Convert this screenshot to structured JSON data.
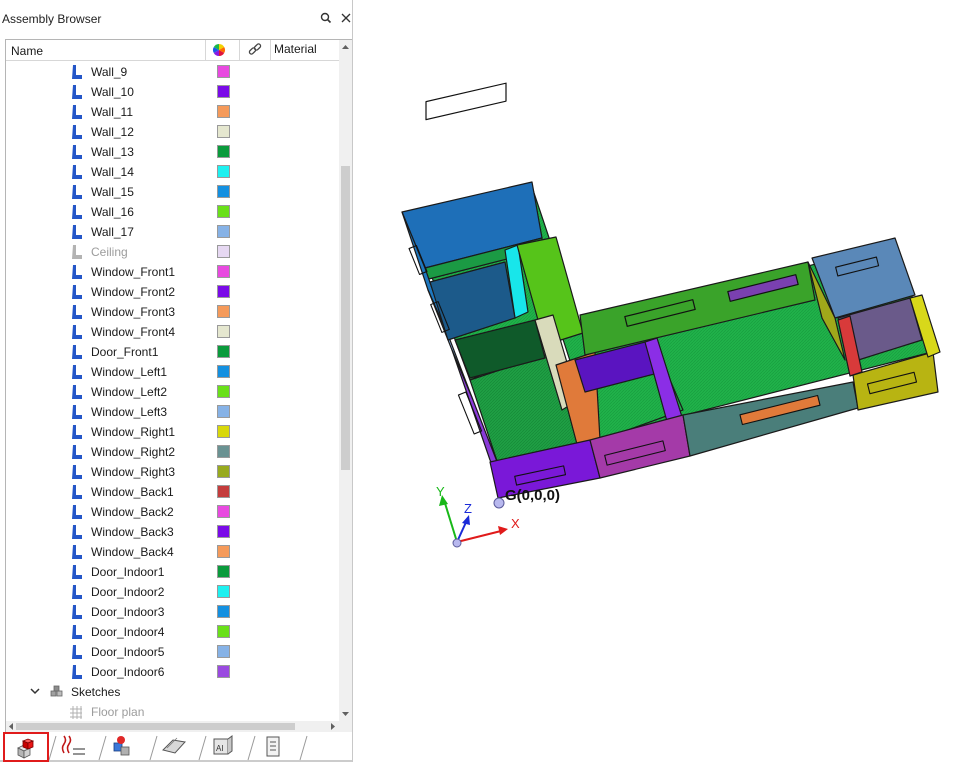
{
  "panel": {
    "title": "Assembly Browser",
    "columns": {
      "name": "Name",
      "material": "Material"
    }
  },
  "items": [
    {
      "label": "Wall_9",
      "color": "#e84ae0",
      "state": "normal"
    },
    {
      "label": "Wall_10",
      "color": "#7a0ae8",
      "state": "normal"
    },
    {
      "label": "Wall_11",
      "color": "#f59a5a",
      "state": "normal"
    },
    {
      "label": "Wall_12",
      "color": "#e5e7cf",
      "state": "normal"
    },
    {
      "label": "Wall_13",
      "color": "#0a9a3c",
      "state": "normal"
    },
    {
      "label": "Wall_14",
      "color": "#1ef0f0",
      "state": "normal"
    },
    {
      "label": "Wall_15",
      "color": "#1490e0",
      "state": "normal"
    },
    {
      "label": "Wall_16",
      "color": "#6ae01a",
      "state": "normal"
    },
    {
      "label": "Wall_17",
      "color": "#86b2e6",
      "state": "normal"
    },
    {
      "label": "Ceiling",
      "color": "#e6d8f2",
      "state": "dim"
    },
    {
      "label": "Window_Front1",
      "color": "#e84ae0",
      "state": "normal"
    },
    {
      "label": "Window_Front2",
      "color": "#7a0ae8",
      "state": "normal"
    },
    {
      "label": "Window_Front3",
      "color": "#f59a5a",
      "state": "normal"
    },
    {
      "label": "Window_Front4",
      "color": "#e5e7cf",
      "state": "normal"
    },
    {
      "label": "Door_Front1",
      "color": "#0a9a3c",
      "state": "normal"
    },
    {
      "label": "Window_Left1",
      "color": "#1490e0",
      "state": "normal"
    },
    {
      "label": "Window_Left2",
      "color": "#6ae01a",
      "state": "normal"
    },
    {
      "label": "Window_Left3",
      "color": "#86b2e6",
      "state": "normal"
    },
    {
      "label": "Window_Right1",
      "color": "#d8d80a",
      "state": "normal"
    },
    {
      "label": "Window_Right2",
      "color": "#6a9292",
      "state": "normal"
    },
    {
      "label": "Window_Right3",
      "color": "#98aa1e",
      "state": "normal"
    },
    {
      "label": "Window_Back1",
      "color": "#c43c3c",
      "state": "normal"
    },
    {
      "label": "Window_Back2",
      "color": "#e84ae0",
      "state": "normal"
    },
    {
      "label": "Window_Back3",
      "color": "#7a0ae8",
      "state": "normal"
    },
    {
      "label": "Window_Back4",
      "color": "#f59a5a",
      "state": "normal"
    },
    {
      "label": "Door_Indoor1",
      "color": "#0a9a3c",
      "state": "normal"
    },
    {
      "label": "Door_Indoor2",
      "color": "#1ef0f0",
      "state": "normal"
    },
    {
      "label": "Door_Indoor3",
      "color": "#1490e0",
      "state": "normal"
    },
    {
      "label": "Door_Indoor4",
      "color": "#6ae01a",
      "state": "normal"
    },
    {
      "label": "Door_Indoor5",
      "color": "#86b2e6",
      "state": "normal"
    },
    {
      "label": "Door_Indoor6",
      "color": "#9a4ae0",
      "state": "normal"
    }
  ],
  "sketches": {
    "label": "Sketches",
    "children": [
      {
        "label": "Floor plan",
        "state": "dim"
      }
    ]
  },
  "viewport": {
    "origin_label": "G(0,0,0)",
    "axis_x": "X",
    "axis_y": "Y",
    "axis_z": "Z"
  }
}
